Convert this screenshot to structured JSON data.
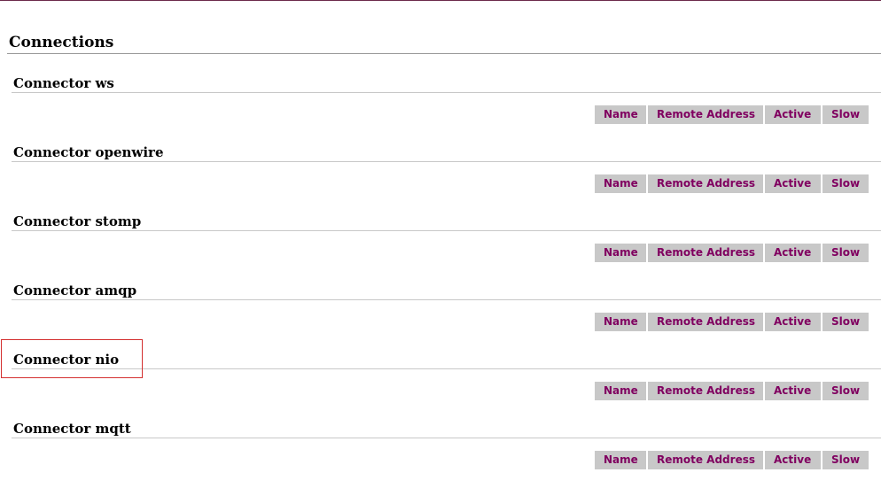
{
  "page": {
    "title": "Connections",
    "accent_color": "#800060",
    "header_cell_bg": "#c8c8c8",
    "highlight_color": "#d32f2f"
  },
  "columns": [
    "Name",
    "Remote Address",
    "Active",
    "Slow"
  ],
  "connectors": [
    {
      "heading": "Connector ws"
    },
    {
      "heading": "Connector openwire"
    },
    {
      "heading": "Connector stomp"
    },
    {
      "heading": "Connector amqp"
    },
    {
      "heading": "Connector nio"
    },
    {
      "heading": "Connector mqtt"
    }
  ]
}
